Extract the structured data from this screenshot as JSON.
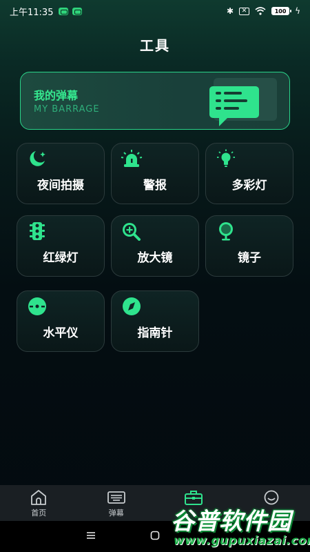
{
  "status_bar": {
    "time": "上午11:35",
    "battery": "100"
  },
  "page": {
    "title": "工具"
  },
  "barrage_card": {
    "title": "我的弹幕",
    "subtitle": "MY BARRAGE"
  },
  "tools": [
    {
      "label": "夜间拍摄",
      "icon": "moon-icon"
    },
    {
      "label": "警报",
      "icon": "siren-icon"
    },
    {
      "label": "多彩灯",
      "icon": "bulb-icon"
    },
    {
      "label": "红绿灯",
      "icon": "traffic-light-icon"
    },
    {
      "label": "放大镜",
      "icon": "magnifier-icon"
    },
    {
      "label": "镜子",
      "icon": "mirror-icon"
    },
    {
      "label": "水平仪",
      "icon": "level-icon"
    },
    {
      "label": "指南针",
      "icon": "compass-icon"
    }
  ],
  "tab_bar": {
    "items": [
      {
        "label": "首页",
        "icon": "home-icon"
      },
      {
        "label": "弹幕",
        "icon": "keyboard-icon"
      },
      {
        "label": "",
        "icon": "toolbox-icon"
      },
      {
        "label": "",
        "icon": "smile-icon"
      }
    ],
    "active_index": 2
  },
  "watermark": {
    "text": "谷普软件园",
    "url": "www.gupuxiazai.com"
  },
  "colors": {
    "accent": "#2fe38d",
    "card_border": "#2c3b3c",
    "tab_bar_bg": "#1a1f23"
  }
}
